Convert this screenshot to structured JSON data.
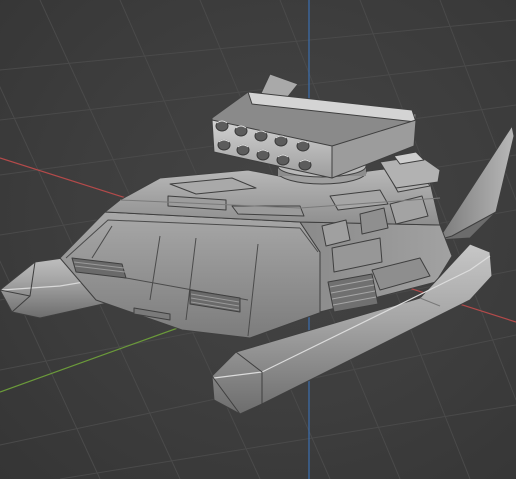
{
  "viewport": {
    "mode": "3d-viewport",
    "shading": "solid",
    "background_color": "#3d3d3d",
    "grid_color": "#4a4a4a",
    "x_axis_color": "#b34a4a",
    "y_axis_color": "#6b9a3a",
    "z_axis_color": "#3b6fb0",
    "model_base_color": "#8c8c8c",
    "model_light_color": "#c4c4c4",
    "model_dark_color": "#5a5a5a"
  },
  "model": {
    "icon": "hovercraft-tank-model",
    "launcher_tubes": 10
  }
}
